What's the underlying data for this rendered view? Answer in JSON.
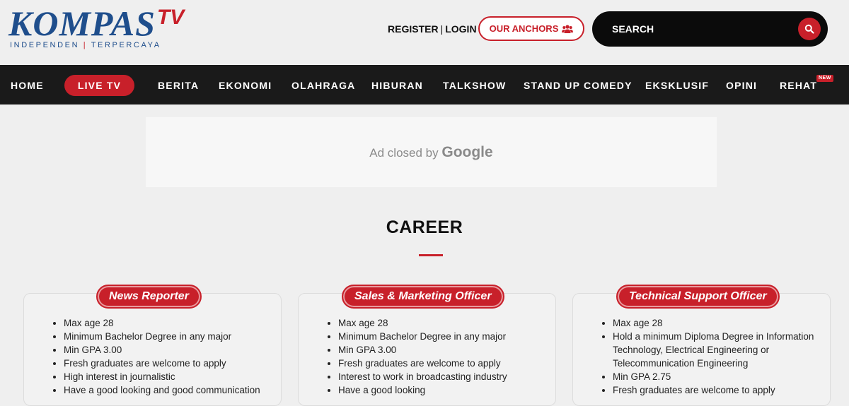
{
  "logo": {
    "brand": "KOMPAS",
    "tv": "TV",
    "tagline_left": "INDEPENDEN",
    "tagline_sep": "|",
    "tagline_right": "TERPERCAYA"
  },
  "header": {
    "register": "REGISTER",
    "divider": "|",
    "login": "LOGIN",
    "anchors_label": "OUR ANCHORS",
    "anchors_icon": "users-icon",
    "search_placeholder": "SEARCH",
    "search_icon": "search-icon"
  },
  "nav": {
    "items": [
      "HOME",
      "LIVE TV",
      "BERITA",
      "EKONOMI",
      "OLAHRAGA",
      "HIBURAN",
      "TALKSHOW",
      "STAND UP COMEDY",
      "EKSKLUSIF",
      "OPINI",
      "REHAT"
    ],
    "new_badge": "NEW"
  },
  "ad": {
    "text": "Ad closed by",
    "brand": "Google"
  },
  "career": {
    "title": "CAREER",
    "cards": [
      {
        "title": "News Reporter",
        "items": [
          "Max age 28",
          "Minimum Bachelor Degree in any major",
          "Min GPA 3.00",
          "Fresh graduates are welcome to apply",
          "High interest in journalistic",
          "Have a good looking and good communication"
        ]
      },
      {
        "title": "Sales & Marketing Officer",
        "items": [
          "Max age 28",
          "Minimum Bachelor Degree in any major",
          "Min GPA 3.00",
          "Fresh graduates are welcome to apply",
          "Interest to work in broadcasting industry",
          "Have a good looking"
        ]
      },
      {
        "title": "Technical Support Officer",
        "items": [
          "Max age 28",
          "Hold a minimum Diploma Degree in Information Technology, Electrical Engineering or Telecommunication Engineering",
          "Min GPA 2.75",
          "Fresh graduates are welcome to apply"
        ]
      }
    ]
  },
  "colors": {
    "accent": "#c8202a",
    "brand_blue": "#1f4e8c",
    "nav_bg": "#1a1a1a"
  }
}
